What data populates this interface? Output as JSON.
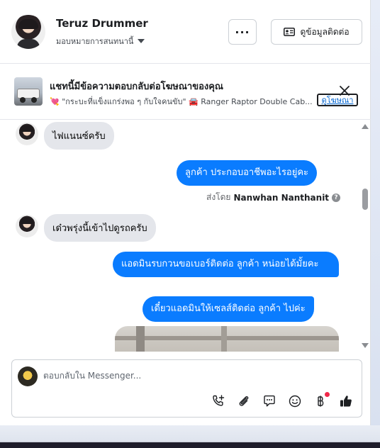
{
  "header": {
    "contact_name": "Teruz Drummer",
    "assign_label": "มอบหมายการสนทนานี้",
    "more_label": "···",
    "contact_info_label": "ดูข้อมูลติดต่อ"
  },
  "ad": {
    "title": "แชทนี้มีข้อความตอบกลับต่อโฆษณาของคุณ",
    "subtitle": "💘 \"กระบะที่แข็งแกร่งพอ ๆ กับใจคนขับ\" 🚘 Ranger Raptor Double Cab...",
    "view_ad_label": "ดูโฆษณา"
  },
  "messages": {
    "m1": "ไฟแนนซ์ครับ",
    "m2": "ลูกค้า  ประกอบอาชีพอะไรอยู่คะ",
    "sent_by_prefix": "ส่งโดย",
    "sent_by_name": "Nanwhan Nanthanit",
    "m3": "เด๋วพรุ่งนี้เข้าไปดูรถครับ",
    "m4": "แอดมินรบกวนขอเบอร์ติดต่อ ลูกค้า  หน่อยได้มั้ยคะ",
    "m5": "เดี๋ยวแอดมินให้เซลส์ติดต่อ ลูกค้า  ไปค่ะ"
  },
  "composer": {
    "placeholder": "ตอบกลับใน Messenger...",
    "value": ""
  },
  "icons": {
    "call": "phone-plus-icon",
    "attach": "paperclip-icon",
    "saved_replies": "chat-bubble-icon",
    "emoji": "smiley-icon",
    "payment": "baht-icon",
    "like": "thumbs-up-icon"
  },
  "colors": {
    "outgoing_bubble": "#0a7cff",
    "incoming_bubble": "#e4e6eb",
    "like": "#1c1e21",
    "notification_dot": "#f02849"
  }
}
